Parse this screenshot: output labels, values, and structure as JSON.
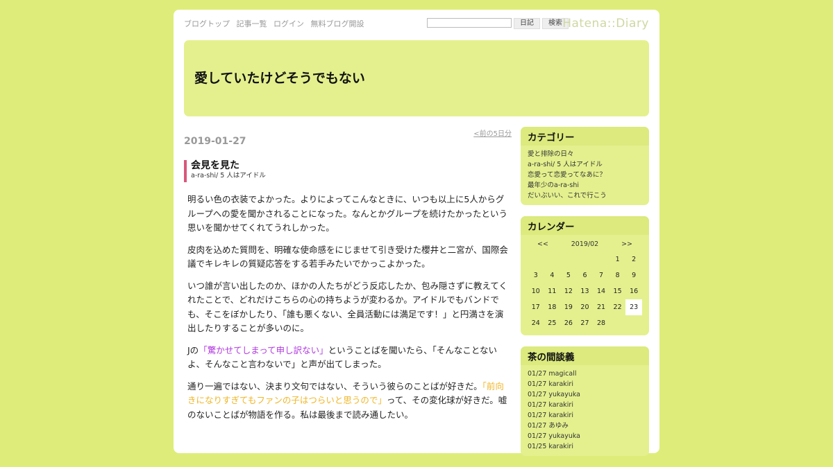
{
  "nav": {
    "links": [
      "ブログトップ",
      "記事一覧",
      "ログイン",
      "無料ブログ開設"
    ],
    "search_placeholder": "",
    "diary_button": "日記",
    "search_button": "検索",
    "logo": "Hatena::Diary"
  },
  "blog": {
    "title": "愛していたけどそうでもない"
  },
  "main": {
    "prev_link": "<前の5日分",
    "date": "2019-01-27",
    "entry": {
      "title": "会見を見た",
      "category": "a-ra-shi/ 5 人はアイドル",
      "paragraphs": {
        "p1": "明るい色の衣装でよかった。よりによってこんなときに、いつも以上に5人からグループへの愛を聞かされることになった。なんとかグループを続けたかったという思いを聞かせてくれてうれしかった。",
        "p2": "皮肉を込めた質問を、明確な使命感をにじませて引き受けた櫻井と二宮が、国際会議でキレキレの質疑応答をする若手みたいでかっこよかった。",
        "p3": "いつ誰が言い出したのか、ほかの人たちがどう反応したか、包み隠さずに教えてくれたことで、どれだけこちらの心の持ちようが変わるか。アイドルでもバンドでも、そこをぼかしたり、「誰も悪くない、全員活動には満足です！」と円満さを演出したりすることが多いのに。",
        "p4a": "Jの",
        "p4b": "「驚かせてしまって申し訳ない」",
        "p4c": "ということばを聞いたら、「そんなことないよ、そんなこと言わないで」と声が出てしまった。",
        "p5a": "通り一遍ではない、決まり文句ではない、そういう彼らのことばが好きだ。",
        "p5b": "「前向きになりすぎてもファンの子はつらいと思うので」",
        "p5c": "って、その変化球が好きだ。嘘のないことばが物語を作る。私は最後まで読み通したい。"
      }
    }
  },
  "sidebar": {
    "categories": {
      "title": "カテゴリー",
      "items": [
        "愛と排除の日々",
        "a-ra-shi/ 5 人はアイドル",
        "恋愛って恋愛ってなあに？",
        "最年少のa-ra-shi",
        "だいぶいい、これで行こう"
      ]
    },
    "calendar": {
      "title": "カレンダー",
      "prev": "<<",
      "month": "2019/02",
      "next": ">>",
      "weeks": [
        [
          "",
          "",
          "",
          "",
          "",
          "1",
          "2"
        ],
        [
          "3",
          "4",
          "5",
          "6",
          "7",
          "8",
          "9"
        ],
        [
          "10",
          "11",
          "12",
          "13",
          "14",
          "15",
          "16"
        ],
        [
          "17",
          "18",
          "19",
          "20",
          "21",
          "22",
          "23"
        ],
        [
          "24",
          "25",
          "26",
          "27",
          "28",
          "",
          ""
        ]
      ],
      "today": "23"
    },
    "comments": {
      "title": "茶の間談義",
      "items": [
        "01/27 magicall",
        "01/27 karakiri",
        "01/27 yukayuka",
        "01/27 karakiri",
        "01/27 karakiri",
        "01/27 あゆみ",
        "01/27 yukayuka",
        "01/25 karakiri"
      ]
    }
  },
  "colors": {
    "background": "#deed7a",
    "header": "#e4f08e",
    "accent_bar": "#d9577c",
    "quote_purple": "#b13be0",
    "quote_orange": "#f0b626"
  }
}
